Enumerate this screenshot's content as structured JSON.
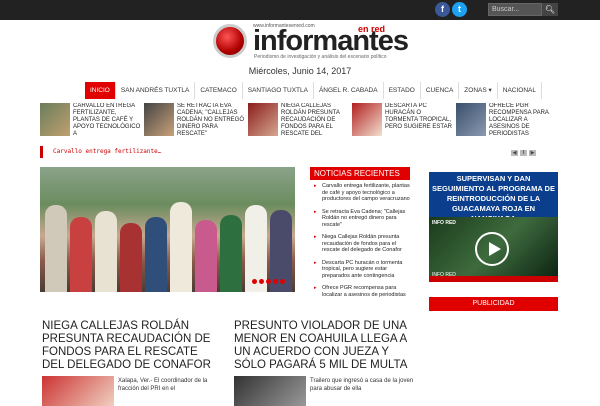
{
  "topbar": {
    "facebook_icon": "facebook-icon",
    "twitter_icon": "twitter-icon",
    "search_placeholder": "Buscar...",
    "search_icon": "search-icon"
  },
  "header": {
    "logo_url": "www.informantesenred.com",
    "logo_text": "informantes",
    "logo_suffix": "en red",
    "logo_tagline": "Periodismo de investigación y análisis del escenario político",
    "date": "Miércoles, Junio 14, 2017"
  },
  "nav": {
    "items": [
      "INICIO",
      "SAN ANDRÉS TUXTLA",
      "CATEMACO",
      "SANTIAGO TUXTLA",
      "ÁNGEL R. CABADA",
      "ESTADO",
      "CUENCA",
      "ZONAS ▾",
      "NACIONAL"
    ]
  },
  "ticker": {
    "items": [
      "CARVALLO ENTREGA FERTILIZANTE, PLANTAS DE CAFÉ Y APOYO TECNOLÓGICO A",
      "SE RETRACTA EVA CADENA; \"CALLEJAS ROLDÁN NO ENTREGÓ DINERO PARA RESCATE\"",
      "NIEGA CALLEJAS ROLDÁN PRESUNTA RECAUDACIÓN DE FONDOS PARA EL RESCATE DEL",
      "DESCARTA PC HURACÁN O TORMENTA TROPICAL, PERO SUGIERE ESTAR",
      "OFRECE PGR RECOMPENSA PARA LOCALIZAR A ASESINOS DE PERIODISTAS"
    ]
  },
  "breaking": {
    "text": "Carvallo entrega fertilizante…",
    "controls": [
      "◀",
      "‖",
      "▶"
    ]
  },
  "recent": {
    "title": "NOTICIAS RECIENTES",
    "items": [
      "Carvallo entrega fertilizante, plantas de café y apoyo tecnológico a productores del campo veracruzano",
      "Se retracta Eva Cadena; \"Callejas Roldán no entregó dinero para rescate\"",
      "Niega Callejas Roldán presunta recaudación de fondos para el rescate del delegado de Conafor",
      "Descarta PC huracán o tormenta tropical, pero sugiere estar preparados ante contingencia",
      "Ofrece PGR recompensa para localizar a asesinos de periodistas"
    ]
  },
  "promo": {
    "title": "SUPERVISAN Y DAN SEGUIMIENTO AL PROGRAMA DE REINTRODUCCIÓN DE LA GUACAMAYA ROJA EN NANCIYAGA",
    "video_label": "INFO RED",
    "video_caption": "INFO RED"
  },
  "publicidad": "PUBLICIDAD",
  "articles": [
    {
      "title": "NIEGA CALLEJAS ROLDÁN PRESUNTA RECAUDACIÓN DE FONDOS PARA EL RESCATE DEL DELEGADO DE CONAFOR",
      "body": "Xalapa, Ver.- El coordinador de la fracción del PRI en el"
    },
    {
      "title": "PRESUNTO VIOLADOR DE UNA MENOR EN COAHUILA LLEGA A UN ACUERDO CON JUEZA Y SÓLO PAGARÁ 5 MIL DE MULTA",
      "body": "Trailero que ingresó a casa de la joven para abusar de ella"
    }
  ],
  "colors": {
    "accent": "#e00000",
    "topbar": "#222222",
    "promo_bg": "#0b3e8c"
  }
}
